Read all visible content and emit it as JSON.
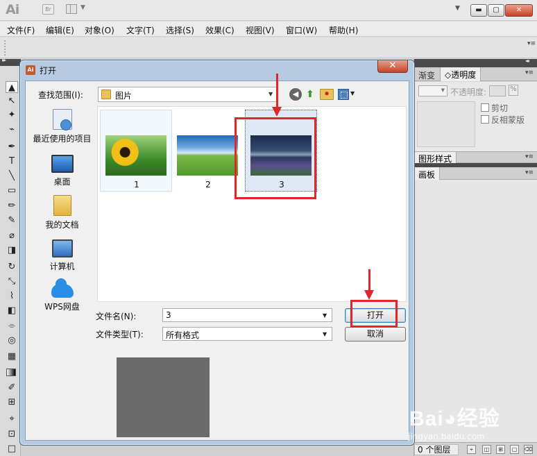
{
  "app": {
    "logo": "Ai",
    "bridge_label": "Br",
    "menus": [
      "文件(F)",
      "编辑(E)",
      "对象(O)",
      "文字(T)",
      "选择(S)",
      "效果(C)",
      "视图(V)",
      "窗口(W)",
      "帮助(H)"
    ],
    "window_min": "▬",
    "window_max": "▢",
    "window_close": "✕"
  },
  "tools": [
    "▲",
    "↖",
    "✦",
    "⌁",
    "✒",
    "T",
    "╲",
    "▭",
    "✏",
    "✎",
    "⌀",
    "◨",
    "↻",
    "⤡",
    "⌇",
    "◧",
    "⌯",
    "◎",
    "▦",
    "◫",
    "▤",
    "✐",
    "⊞",
    "⌖",
    "⊡",
    "▥",
    "□"
  ],
  "right_panel": {
    "gradient_tab": "渐变",
    "transparency_tab": "◇透明度",
    "opacity_label": "不透明度:",
    "opacity_unit": "%",
    "clip_label": "剪切",
    "invert_mask_label": "反相蒙版",
    "graphic_styles_tab": "图形样式",
    "artboards_tab": "画板",
    "layers_count": "0 个图层",
    "menu_glyph": "▾≡"
  },
  "dialog": {
    "title": "打开",
    "close": "✕",
    "icon_label": "Ai",
    "look_in_label": "查找范围(I):",
    "look_in_value": "图片",
    "places": [
      {
        "label": "最近使用的项目"
      },
      {
        "label": "桌面"
      },
      {
        "label": "我的文档"
      },
      {
        "label": "计算机"
      },
      {
        "label": "WPS网盘"
      }
    ],
    "files": [
      {
        "name": "1"
      },
      {
        "name": "2"
      },
      {
        "name": "3"
      }
    ],
    "file_name_label": "文件名(N):",
    "file_name_value": "3",
    "file_type_label": "文件类型(T):",
    "file_type_value": "所有格式",
    "open_button": "打开",
    "cancel_button": "取消"
  },
  "watermark": {
    "logo": "Bai◕经验",
    "url": "jingyan.baidu.com"
  }
}
